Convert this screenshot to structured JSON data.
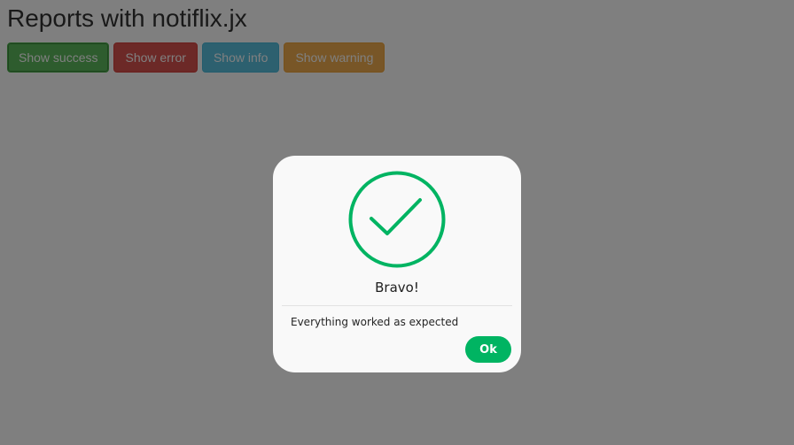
{
  "page": {
    "title": "Reports with notiflix.jx"
  },
  "buttons": {
    "success": "Show success",
    "error": "Show error",
    "info": "Show info",
    "warning": "Show warning"
  },
  "report": {
    "type": "success",
    "icon": "check-circle-icon",
    "title": "Bravo!",
    "message": "Everything worked as expected",
    "ok_label": "Ok"
  },
  "colors": {
    "success": "#5cb85c",
    "error": "#d9534f",
    "info": "#5bc0de",
    "warning": "#f0ad4e",
    "report_accent": "#00b462",
    "overlay": "rgba(0,0,0,0.5)"
  }
}
